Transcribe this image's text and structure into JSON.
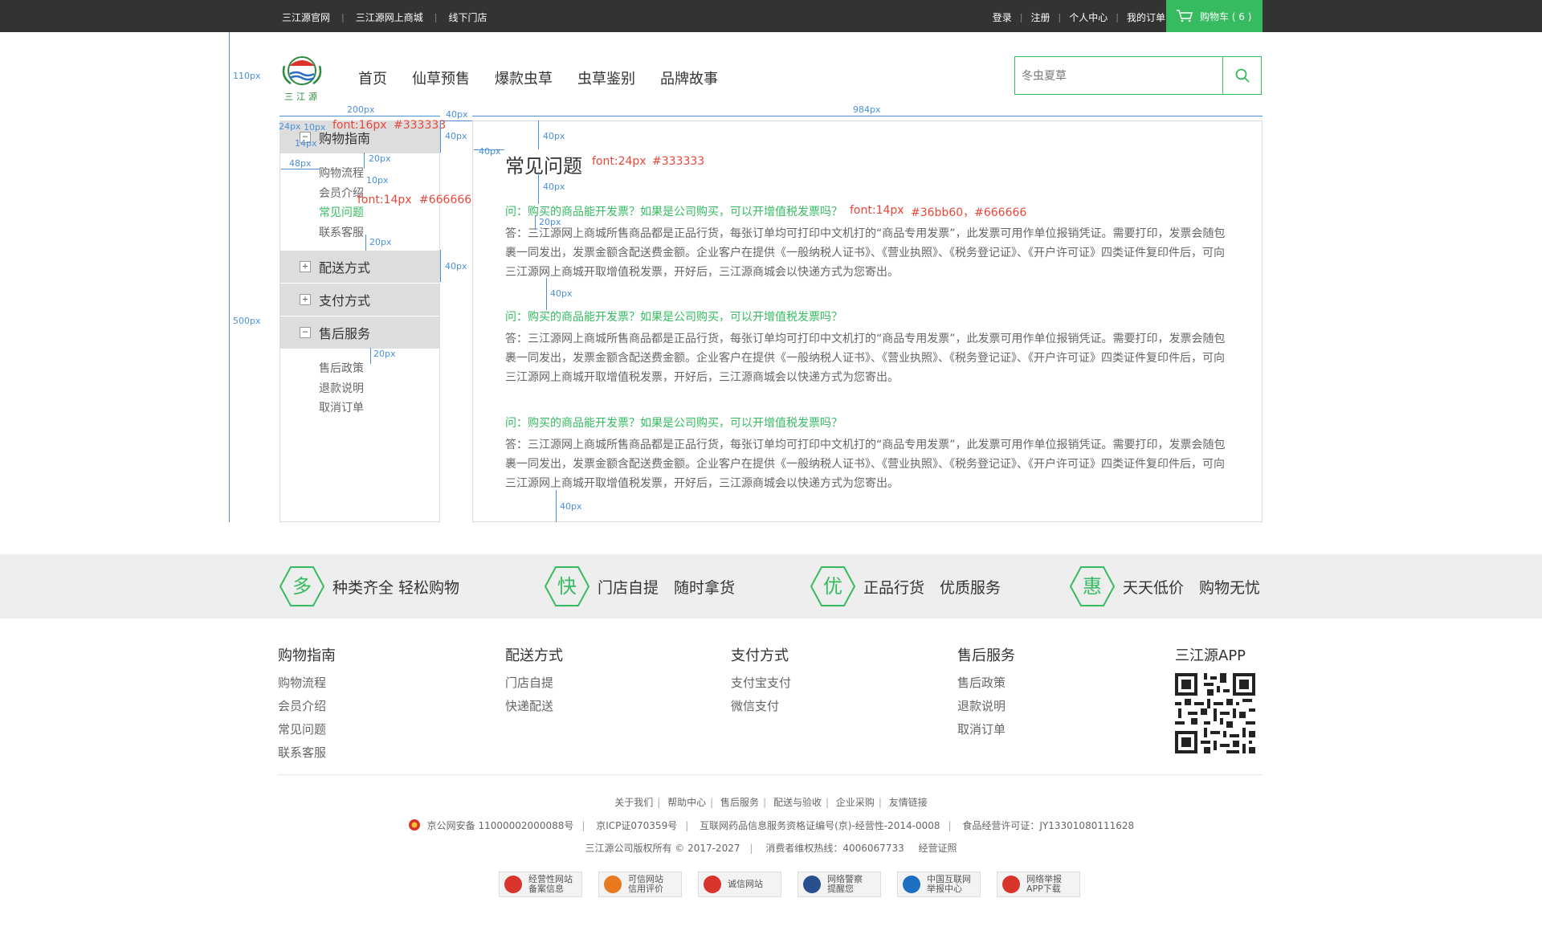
{
  "colors": {
    "accent": "#36bb60",
    "topbar": "#333333",
    "annotation": "#4a90d9",
    "annotation_red": "#e7473b"
  },
  "topbar": {
    "left_links": [
      "三江源官网",
      "三江源网上商城",
      "线下门店"
    ],
    "right_links": [
      "登录",
      "注册",
      "个人中心",
      "我的订单"
    ],
    "cart_label": "购物车 ( 6 )"
  },
  "header": {
    "logo_text": "三江源",
    "nav": [
      "首页",
      "仙草预售",
      "爆款虫草",
      "虫草鉴别",
      "品牌故事"
    ],
    "search_placeholder": "冬虫夏草"
  },
  "sidebar": {
    "sections": [
      {
        "title": "购物指南",
        "toggle": "−",
        "items": [
          "购物流程",
          "会员介绍",
          "常见问题",
          "联系客服"
        ],
        "active": "常见问题"
      },
      {
        "title": "配送方式",
        "toggle": "+",
        "items": []
      },
      {
        "title": "支付方式",
        "toggle": "+",
        "items": []
      },
      {
        "title": "售后服务",
        "toggle": "−",
        "items": [
          "售后政策",
          "退款说明",
          "取消订单"
        ]
      }
    ]
  },
  "main": {
    "title": "常见问题",
    "faqs": [
      {
        "q": "问：购买的商品能开发票？如果是公司购买，可以开增值税发票吗？",
        "a": "答：三江源网上商城所售商品都是正品行货，每张订单均可打印中文机打的“商品专用发票”，此发票可用作单位报销凭证。需要打印，发票会随包裹一同发出，发票金额含配送费金额。企业客户在提供《一般纳税人证书》、《营业执照》、《税务登记证》、《开户许可证》四类证件复印件后，可向三江源网上商城开取增值税发票，开好后，三江源商城会以快递方式为您寄出。"
      },
      {
        "q": "问：购买的商品能开发票？如果是公司购买，可以开增值税发票吗？",
        "a": "答：三江源网上商城所售商品都是正品行货，每张订单均可打印中文机打的“商品专用发票”，此发票可用作单位报销凭证。需要打印，发票会随包裹一同发出，发票金额含配送费金额。企业客户在提供《一般纳税人证书》、《营业执照》、《税务登记证》、《开户许可证》四类证件复印件后，可向三江源网上商城开取增值税发票，开好后，三江源商城会以快递方式为您寄出。"
      },
      {
        "q": "问：购买的商品能开发票？如果是公司购买，可以开增值税发票吗？",
        "a": "答：三江源网上商城所售商品都是正品行货，每张订单均可打印中文机打的“商品专用发票”，此发票可用作单位报销凭证。需要打印，发票会随包裹一同发出，发票金额含配送费金额。企业客户在提供《一般纳税人证书》、《营业执照》、《税务登记证》、《开户许可证》四类证件复印件后，可向三江源网上商城开取增值税发票，开好后，三江源商城会以快递方式为您寄出。"
      }
    ]
  },
  "annotations": {
    "spec_110": "110px",
    "spec_500": "500px",
    "spec_200": "200px",
    "spec_984": "984px",
    "spec_24": "24px",
    "spec_10": "10px",
    "spec_14": "14px",
    "spec_48": "48px",
    "spec_20": "20px",
    "spec_40": "40px",
    "font16": "font:16px",
    "c333": "#333333",
    "font24": "font:24px",
    "c333b": "#333333",
    "font14": "font:14px",
    "c666": "#666666",
    "font14q": "font:14px",
    "cq": "#36bb60，#666666"
  },
  "features": [
    {
      "char": "多",
      "text": "种类齐全 轻松购物"
    },
    {
      "char": "快",
      "text": "门店自提　随时拿货"
    },
    {
      "char": "优",
      "text": "正品行货　优质服务"
    },
    {
      "char": "惠",
      "text": "天天低价　购物无忧"
    }
  ],
  "footer": {
    "columns": [
      {
        "title": "购物指南",
        "items": [
          "购物流程",
          "会员介绍",
          "常见问题",
          "联系客服"
        ]
      },
      {
        "title": "配送方式",
        "items": [
          "门店自提",
          "快递配送"
        ]
      },
      {
        "title": "支付方式",
        "items": [
          "支付宝支付",
          "微信支付"
        ]
      },
      {
        "title": "售后服务",
        "items": [
          "售后政策",
          "退款说明",
          "取消订单"
        ]
      }
    ],
    "app_title": "三江源APP",
    "links": [
      "关于我们",
      "帮助中心",
      "售后服务",
      "配送与验收",
      "企业采购",
      "友情链接"
    ],
    "license": [
      "京公网安备 11000002000088号",
      "京ICP证070359号",
      "互联网药品信息服务资格证编号(京)-经营性-2014-0008",
      "食品经营许可证：JY13301080111628"
    ],
    "copyright": "三江源公司版权所有 © 2017-2027",
    "hotline": "消费者维权热线：4006067733",
    "cert": "经营证照",
    "badges": [
      {
        "l1": "经营性网站",
        "l2": "备案信息",
        "color": "#d9342b"
      },
      {
        "l1": "可信网站",
        "l2": "信用评价",
        "color": "#e8791f"
      },
      {
        "l1": "诚信网站",
        "l2": "",
        "color": "#d9342b"
      },
      {
        "l1": "网络警察",
        "l2": "提醒您",
        "color": "#2a4f8f"
      },
      {
        "l1": "中国互联网",
        "l2": "举报中心",
        "color": "#1c6fc1"
      },
      {
        "l1": "网络举报",
        "l2": "APP下载",
        "color": "#d9342b"
      }
    ]
  }
}
